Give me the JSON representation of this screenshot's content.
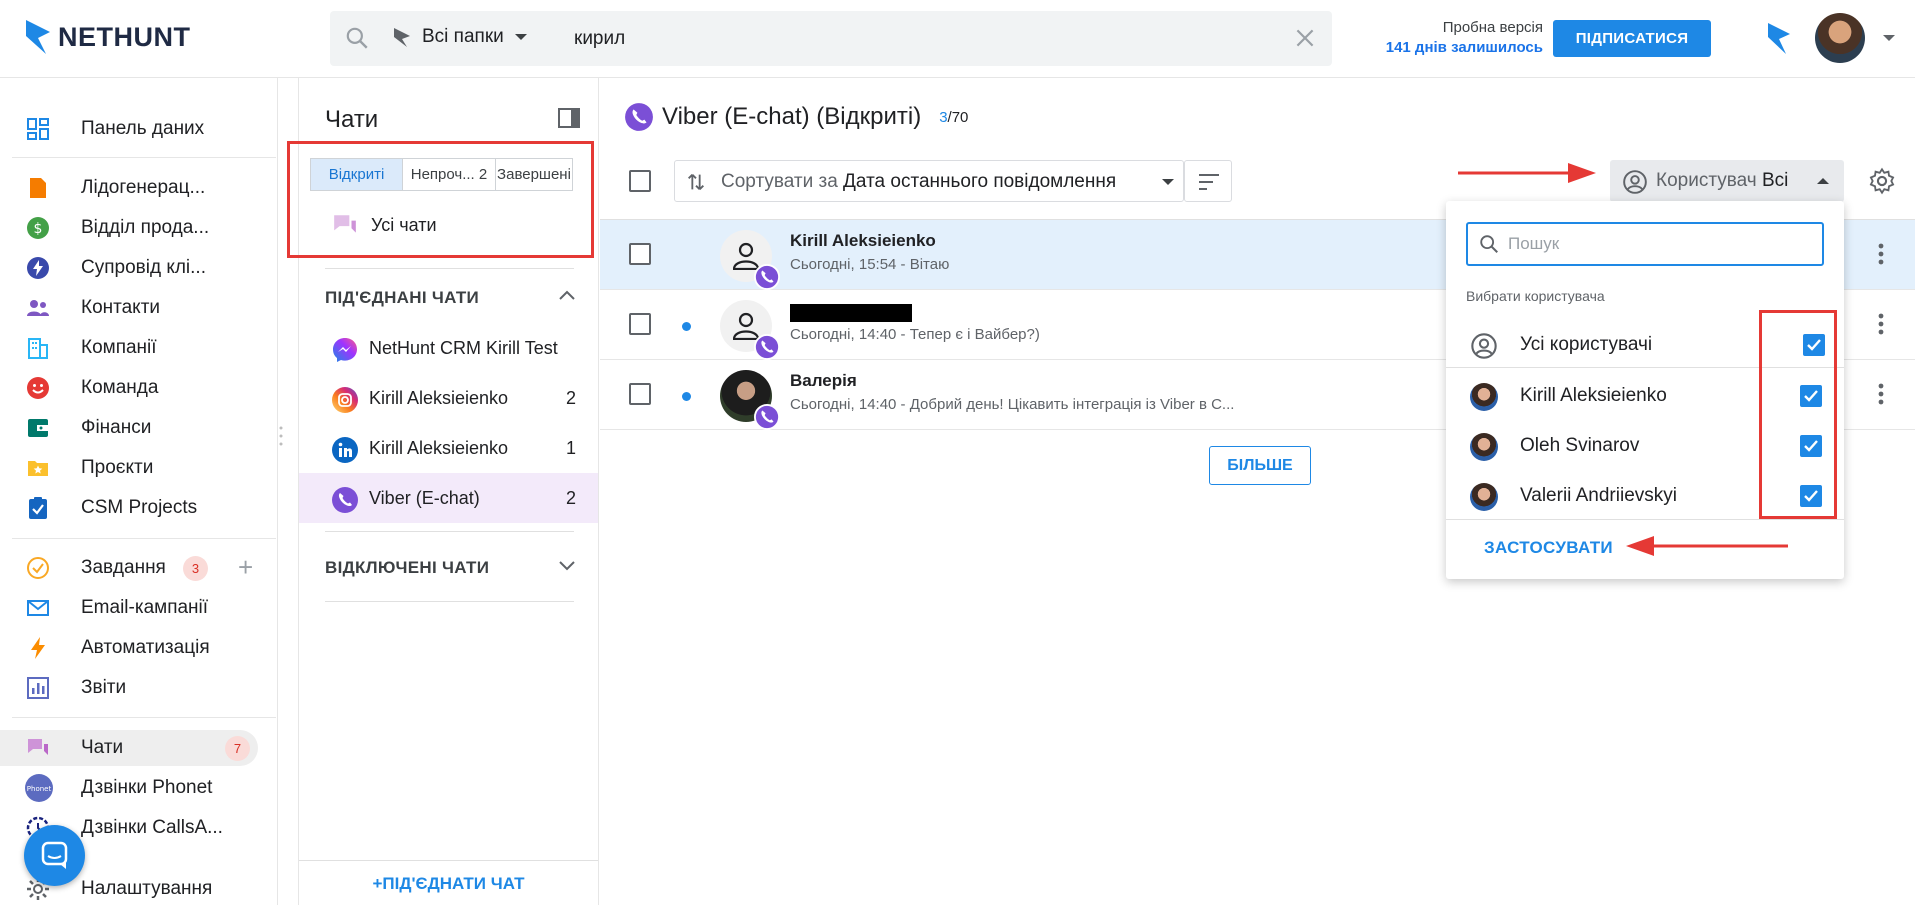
{
  "header": {
    "logo": "NETHUNT",
    "search": {
      "folder": "Всі папки",
      "query": "кирил"
    },
    "trial": {
      "line1": "Пробна версія",
      "line2": "141 днів залишилось"
    },
    "subscribe_label": "ПІДПИСАТИСЯ"
  },
  "sidebar": {
    "items": [
      {
        "label": "Панель даних"
      },
      {
        "label": "Лідогенерац..."
      },
      {
        "label": "Відділ прода..."
      },
      {
        "label": "Супровід клі..."
      },
      {
        "label": "Контакти"
      },
      {
        "label": "Компанії"
      },
      {
        "label": "Команда"
      },
      {
        "label": "Фінанси"
      },
      {
        "label": "Проєкти"
      },
      {
        "label": "CSM Projects"
      },
      {
        "label": "Завдання",
        "badge": "3"
      },
      {
        "label": "Email-кампанії"
      },
      {
        "label": "Автоматизація"
      },
      {
        "label": "Звіти"
      },
      {
        "label": "Чати",
        "badge": "7"
      },
      {
        "label": "Дзвінки Phonet"
      },
      {
        "label": "Дзвінки CallsA..."
      },
      {
        "label": "Налаштування"
      }
    ]
  },
  "chats_panel": {
    "title": "Чати",
    "tabs": [
      {
        "label": "Відкриті"
      },
      {
        "label": "Непроч...",
        "count": "2"
      },
      {
        "label": "Завершені"
      }
    ],
    "all_chats": "Усі чати",
    "connected_header": "ПІД'ЄДНАНІ ЧАТИ",
    "connected": [
      {
        "label": "NetHunt CRM Kirill Test",
        "count": ""
      },
      {
        "label": "Kirill Aleksieienko",
        "count": "2"
      },
      {
        "label": "Kirill Aleksieienko",
        "count": "1"
      },
      {
        "label": "Viber (E-chat)",
        "count": "2"
      }
    ],
    "disconnected_header": "ВІДКЛЮЧЕНІ ЧАТИ",
    "connect_button": "+ПІД'ЄДНАТИ ЧАТ"
  },
  "main": {
    "title": "Viber (E-chat) (Відкриті)",
    "count_current": "3",
    "count_total": "/70",
    "sort": {
      "prefix": "Сортувати за",
      "value": "Дата останнього повідомлення"
    },
    "user_filter": {
      "prefix": "Користувач",
      "value": "Всі"
    },
    "rows": [
      {
        "name": "Kirill Aleksieienko",
        "preview": "Сьогодні, 15:54 - Вітаю"
      },
      {
        "name": "",
        "preview": "Сьогодні, 14:40 - Тепер є і Вайбер?)"
      },
      {
        "name": "Валерія",
        "preview": "Сьогодні, 14:40 - Добрий день! Цікавить інтеграція із Viber в С..."
      }
    ],
    "more_button": "БІЛЬШЕ"
  },
  "user_dropdown": {
    "search_placeholder": "Пошук",
    "section_label": "Вибрати користувача",
    "all_users": "Усі користувачі",
    "users": [
      {
        "name": "Kirill Aleksieienko"
      },
      {
        "name": "Oleh Svinarov"
      },
      {
        "name": "Valerii Andriievskyi"
      }
    ],
    "apply_label": "ЗАСТОСУВАТИ"
  },
  "colors": {
    "accent": "#1e88e5",
    "annotation_red": "#e53935",
    "viber": "#7b4fd6"
  }
}
